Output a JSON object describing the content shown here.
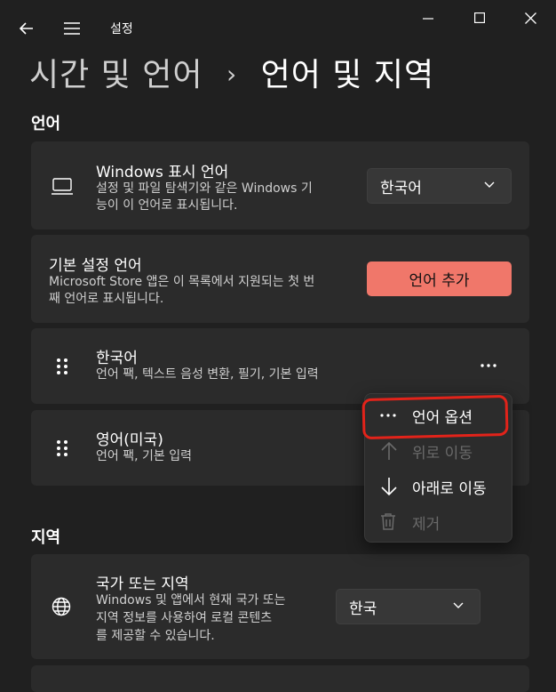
{
  "window": {
    "title": "설정"
  },
  "header": {
    "parent": "시간 및 언어",
    "separator": "›",
    "current": "언어 및 지역"
  },
  "language_section": {
    "title": "언어",
    "display_language": {
      "title": "Windows 표시 언어",
      "desc_line1": "설정 및 파일 탐색기와 같은 Windows 기",
      "desc_line2": "능이 이 언어로 표시됩니다.",
      "selected": "한국어"
    },
    "preferred": {
      "title": "기본 설정 언어",
      "desc_line1": "Microsoft Store 앱은 이 목록에서 지원되는 첫 번",
      "desc_line2": "째 언어로 표시됩니다.",
      "add_button": "언어 추가"
    },
    "languages": [
      {
        "name": "한국어",
        "features": "언어 팩, 텍스트 음성 변환, 필기, 기본 입력"
      },
      {
        "name": "영어(미국)",
        "features": "언어 팩, 기본 입력"
      }
    ]
  },
  "context_menu": {
    "items": [
      {
        "label": "언어 옵션",
        "icon": "more-horizontal-icon",
        "enabled": true
      },
      {
        "label": "위로 이동",
        "icon": "arrow-up-icon",
        "enabled": false
      },
      {
        "label": "아래로 이동",
        "icon": "arrow-down-icon",
        "enabled": true
      },
      {
        "label": "제거",
        "icon": "trash-icon",
        "enabled": false
      }
    ]
  },
  "region_section": {
    "title": "지역",
    "country": {
      "title": "국가 또는 지역",
      "desc_line1": "Windows 및 앱에서 현재 국가 또는",
      "desc_line2": "지역 정보를 사용하여 로컬 콘텐츠",
      "desc_line3": "를 제공할 수 있습니다.",
      "selected": "한국"
    }
  },
  "colors": {
    "accent": "#f0776a",
    "annotation": "#e2231a",
    "background": "#202020",
    "card": "#2b2b2b"
  }
}
